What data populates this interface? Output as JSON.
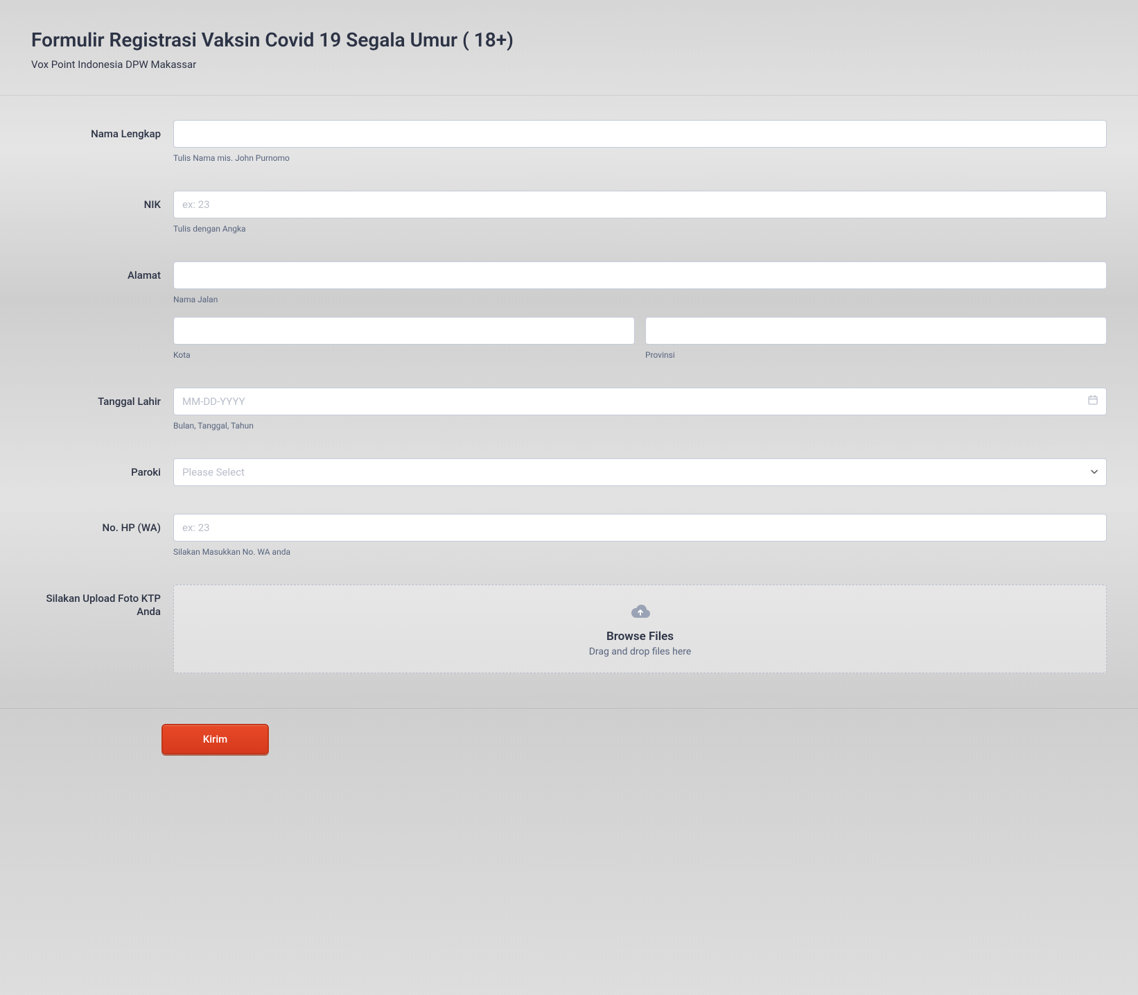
{
  "header": {
    "title": "Formulir Registrasi Vaksin Covid 19 Segala Umur ( 18+)",
    "subtitle": "Vox Point Indonesia DPW Makassar"
  },
  "fields": {
    "fullname": {
      "label": "Nama Lengkap",
      "hint": "Tulis Nama mis. John Purnomo",
      "value": ""
    },
    "nik": {
      "label": "NIK",
      "placeholder": "ex: 23",
      "hint": "Tulis dengan Angka",
      "value": ""
    },
    "address": {
      "label": "Alamat",
      "street_hint": "Nama Jalan",
      "city_hint": "Kota",
      "province_hint": "Provinsi",
      "street_value": "",
      "city_value": "",
      "province_value": ""
    },
    "birthdate": {
      "label": "Tanggal Lahir",
      "placeholder": "MM-DD-YYYY",
      "hint": "Bulan, Tanggal, Tahun",
      "value": ""
    },
    "paroki": {
      "label": "Paroki",
      "placeholder": "Please Select",
      "value": ""
    },
    "phone": {
      "label": "No. HP (WA)",
      "placeholder": "ex: 23",
      "hint": "Silakan Masukkan No. WA anda",
      "value": ""
    },
    "upload": {
      "label": "Silakan Upload Foto KTP Anda",
      "browse_text": "Browse Files",
      "dnd_text": "Drag and drop files here"
    }
  },
  "submit": {
    "label": "Kirim"
  }
}
